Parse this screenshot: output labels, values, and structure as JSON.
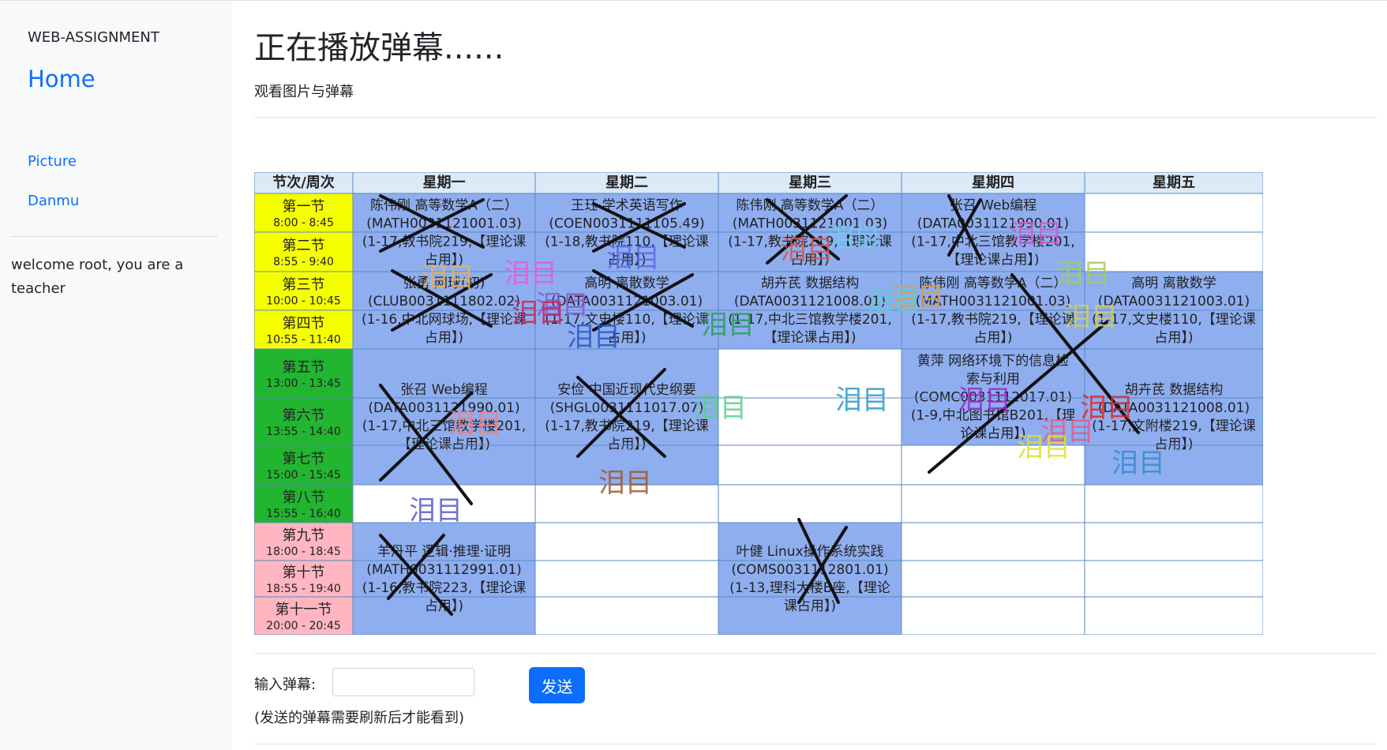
{
  "sidebar": {
    "brand": "WEB-ASSIGNMENT",
    "home": "Home",
    "links": [
      {
        "label": "Picture"
      },
      {
        "label": "Danmu"
      }
    ],
    "welcome": "welcome root, you are a teacher"
  },
  "main": {
    "title": "正在播放弹幕......",
    "subtitle": "观看图片与弹幕"
  },
  "schedule": {
    "corner": "节次/周次",
    "days": [
      "星期一",
      "星期二",
      "星期三",
      "星期四",
      "星期五"
    ],
    "periods": [
      {
        "name": "第一节",
        "time": "8:00 - 8:45",
        "color": "#f5ff00"
      },
      {
        "name": "第二节",
        "time": "8:55 - 9:40",
        "color": "#f5ff00"
      },
      {
        "name": "第三节",
        "time": "10:00 - 10:45",
        "color": "#f5ff00"
      },
      {
        "name": "第四节",
        "time": "10:55 - 11:40",
        "color": "#f5ff00"
      },
      {
        "name": "第五节",
        "time": "13:00 - 13:45",
        "color": "#22b530"
      },
      {
        "name": "第六节",
        "time": "13:55 - 14:40",
        "color": "#22b530"
      },
      {
        "name": "第七节",
        "time": "15:00 - 15:45",
        "color": "#22b530"
      },
      {
        "name": "第八节",
        "time": "15:55 - 16:40",
        "color": "#22b530"
      },
      {
        "name": "第九节",
        "time": "18:00 - 18:45",
        "color": "#ffb6c1"
      },
      {
        "name": "第十节",
        "time": "18:55 - 19:40",
        "color": "#ffb6c1"
      },
      {
        "name": "第十一节",
        "time": "20:00 - 20:45",
        "color": "#ffb6c1"
      }
    ],
    "courses": [
      {
        "day": 1,
        "start": 1,
        "end": 2,
        "lines": [
          "陈伟刚 高等数学A（二）",
          "(MATH0031121001.03)",
          "(1-17,教书院219,【理论课",
          "占用】)"
        ]
      },
      {
        "day": 2,
        "start": 1,
        "end": 2,
        "lines": [
          "王珏 学术英语写作",
          "(COEN0031111105.49)",
          "(1-18,教书院110,【理论课",
          "占用】)"
        ]
      },
      {
        "day": 3,
        "start": 1,
        "end": 2,
        "lines": [
          "陈伟刚 高等数学A（二）",
          "(MATH0031121001.03)",
          "(1-17,教书院219,【理论课",
          "占用】)"
        ]
      },
      {
        "day": 4,
        "start": 1,
        "end": 2,
        "lines": [
          "张召 Web编程",
          "(DATA0031121990.01)",
          "(1-17,中北三馆教学楼201,",
          "【理论课占用】)"
        ]
      },
      {
        "day": 1,
        "start": 3,
        "end": 4,
        "lines": [
          "张勇 网球(初)",
          "(CLUB0031111802.02)",
          "(1-16,中北网球场,【理论课",
          "占用】)"
        ]
      },
      {
        "day": 2,
        "start": 3,
        "end": 4,
        "lines": [
          "高明 离散数学",
          "(DATA0031121003.01)",
          "(1-17,文史楼110,【理论课",
          "占用】)"
        ]
      },
      {
        "day": 3,
        "start": 3,
        "end": 4,
        "lines": [
          "胡卉芪 数据结构",
          "(DATA0031121008.01)",
          "(1-17,中北三馆教学楼201,",
          "【理论课占用】)"
        ]
      },
      {
        "day": 4,
        "start": 3,
        "end": 4,
        "lines": [
          "陈伟刚 高等数学A（二）",
          "(MATH0031121001.03)",
          "(1-17,教书院219,【理论课",
          "占用】)"
        ]
      },
      {
        "day": 5,
        "start": 3,
        "end": 4,
        "lines": [
          "高明 离散数学",
          "(DATA0031121003.01)",
          "(1-17,文史楼110,【理论课",
          "占用】)"
        ]
      },
      {
        "day": 1,
        "start": 5,
        "end": 7,
        "lines": [
          "张召 Web编程",
          "(DATA0031121990.01)",
          "(1-17,中北三馆教学楼201,",
          "【理论课占用】)"
        ]
      },
      {
        "day": 2,
        "start": 5,
        "end": 7,
        "lines": [
          "安俭 中国近现代史纲要",
          "(SHGL0031111017.07)",
          "(1-17,教书院219,【理论课",
          "占用】)"
        ]
      },
      {
        "day": 4,
        "start": 5,
        "end": 6,
        "lines": [
          "黄萍 网络环境下的信息检",
          "索与利用",
          "(COMC0031112017.01)",
          "(1-9,中北图书馆B201,【理",
          "论课占用】)"
        ]
      },
      {
        "day": 5,
        "start": 5,
        "end": 7,
        "lines": [
          "胡卉芪 数据结构",
          "(DATA0031121008.01)",
          "(1-17,文附楼219,【理论课",
          "占用】)"
        ]
      },
      {
        "day": 1,
        "start": 9,
        "end": 11,
        "lines": [
          "羊丹平 逻辑·推理·证明",
          "(MATH0031112991.01)",
          "(1-16,教书院223,【理论课",
          "占用】)"
        ]
      },
      {
        "day": 3,
        "start": 9,
        "end": 11,
        "lines": [
          "叶健 Linux操作系统实践",
          "(COMS0031112801.01)",
          "(1-13,理科大楼B座,【理论",
          "课占用】)"
        ]
      }
    ],
    "danmu_text": "泪目",
    "danmu": [
      {
        "color": "#e8b15a"
      },
      {
        "color": "#e85ae0"
      },
      {
        "color": "#6ad0f0"
      },
      {
        "color": "#5a6ae8"
      },
      {
        "color": "#5ad08a"
      },
      {
        "color": "#f08080"
      },
      {
        "color": "#d05a5a"
      },
      {
        "color": "#8a5ad0"
      },
      {
        "color": "#d0a05a"
      },
      {
        "color": "#3a8ad0"
      },
      {
        "color": "#e85a8a"
      },
      {
        "color": "#a0d05a"
      },
      {
        "color": "#5a5ad0"
      },
      {
        "color": "#d05ad0"
      },
      {
        "color": "#5ad0d0"
      },
      {
        "color": "#d0d05a"
      },
      {
        "color": "#a05a2a"
      },
      {
        "color": "#2aa05a"
      },
      {
        "color": "#c02a5a"
      },
      {
        "color": "#2a5ac0"
      },
      {
        "color": "#e0e02a"
      },
      {
        "color": "#e02a2a"
      },
      {
        "color": "#9a2ad0"
      },
      {
        "color": "#2a9ad0"
      }
    ]
  },
  "form": {
    "label": "输入弹幕:",
    "input_value": "",
    "button": "发送",
    "note": "(发送的弹幕需要刷新后才能看到)"
  }
}
